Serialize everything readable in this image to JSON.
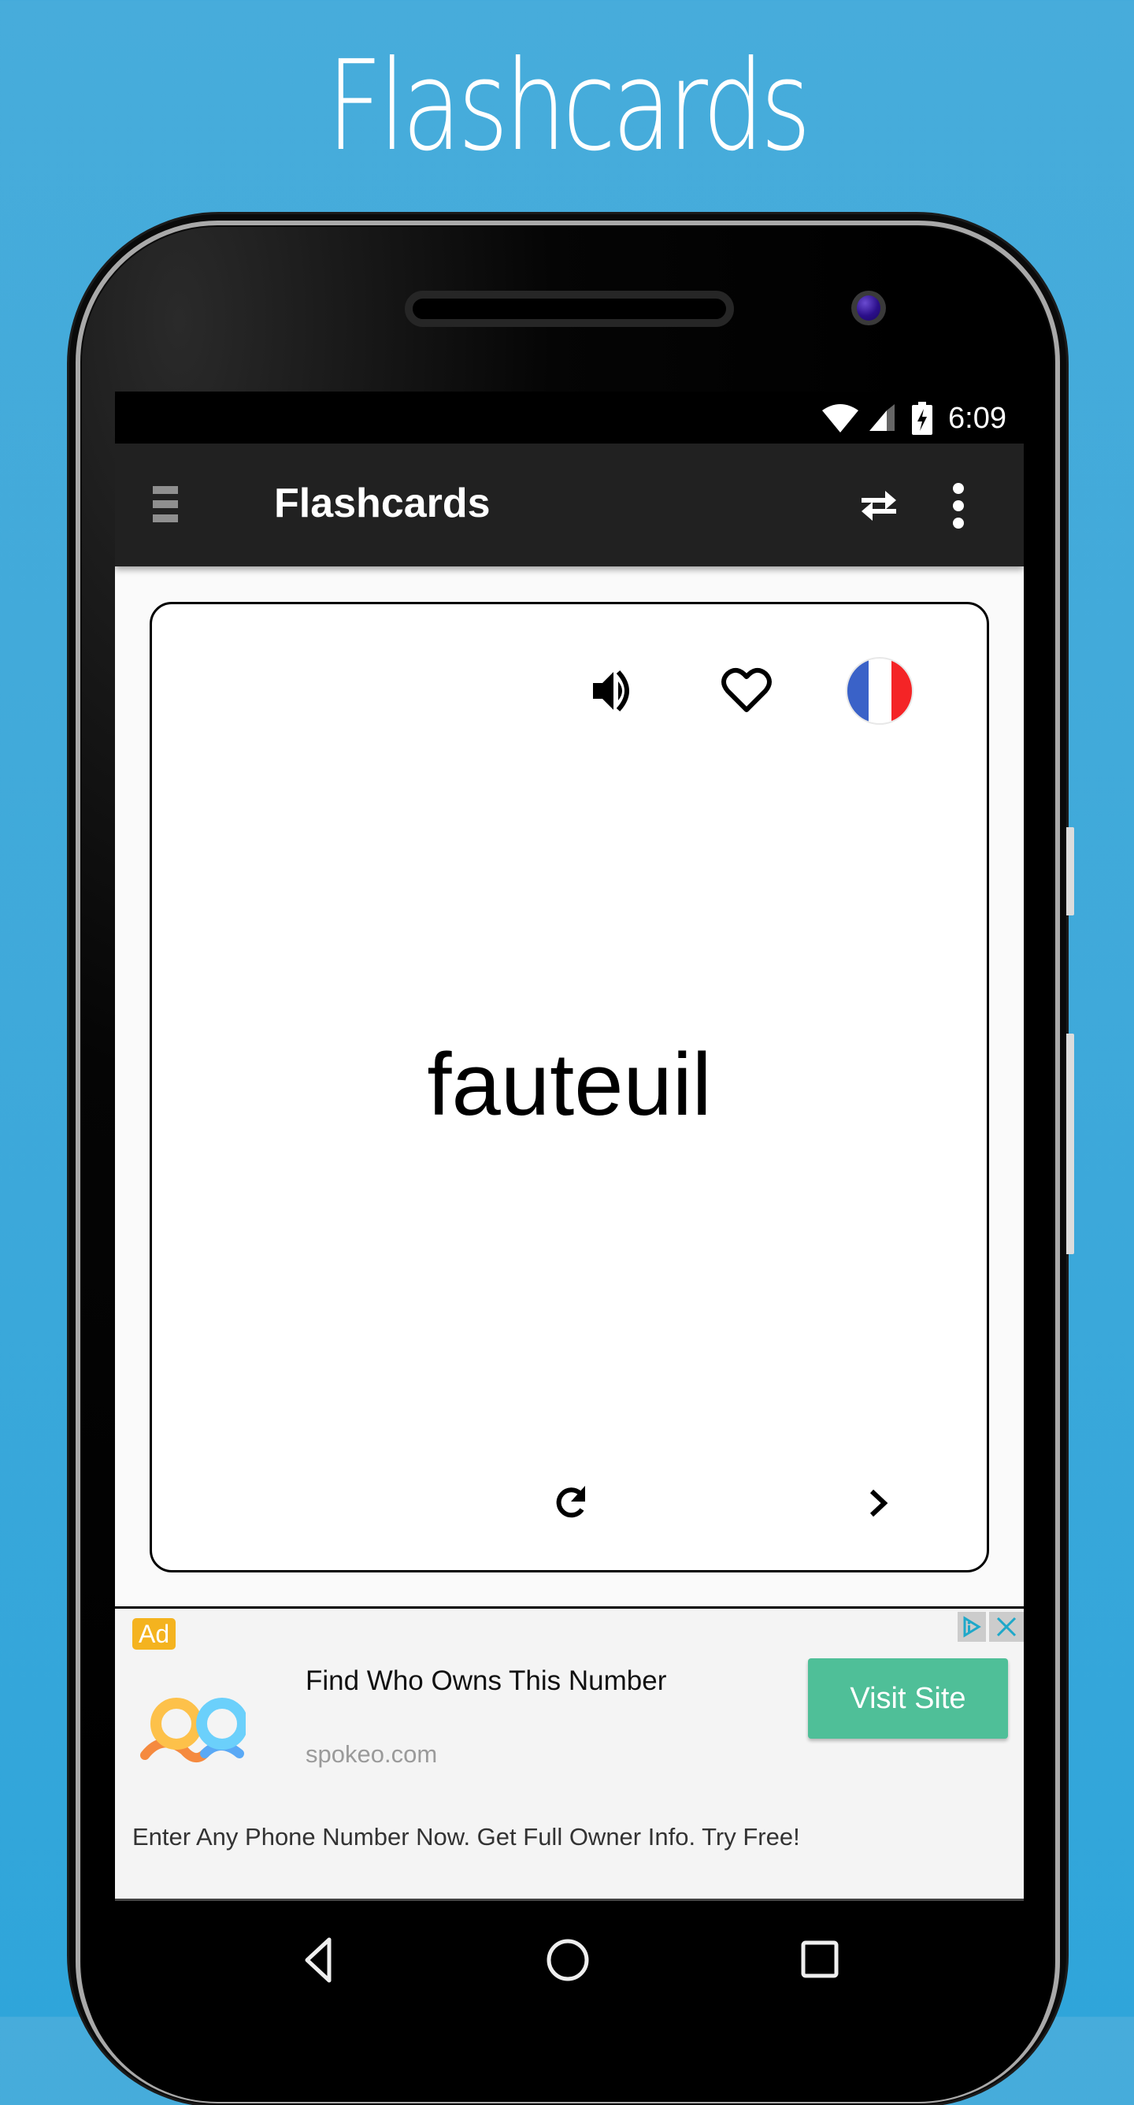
{
  "promo": {
    "title": "Flashcards"
  },
  "status_bar": {
    "time": "6:09",
    "icons": [
      "wifi-icon",
      "cell-signal-icon",
      "battery-charging-icon"
    ]
  },
  "app_bar": {
    "title": "Flashcards",
    "icons": {
      "menu": "hamburger-menu-icon",
      "swap": "swap-arrows-icon",
      "more": "more-vertical-icon"
    }
  },
  "flashcard": {
    "word": "fauteuil",
    "language": "French",
    "icons": {
      "speaker": "volume-up-icon",
      "favorite": "heart-outline-icon",
      "flag": "france-flag-icon",
      "flip": "refresh-icon",
      "next": "chevron-right-icon"
    }
  },
  "ad": {
    "badge": "Ad",
    "headline": "Find Who Owns This Number",
    "domain": "spokeo.com",
    "cta": "Visit Site",
    "body": "Enter Any Phone Number Now. Get Full Owner Info. Try Free!",
    "colors": {
      "badge": "#f4b31f",
      "cta": "#4fbf98",
      "adchoices": "#1fa8c9"
    }
  },
  "nav_bar": {
    "buttons": [
      "back-icon",
      "home-icon",
      "recents-icon"
    ]
  },
  "colors": {
    "background": "#3fa9da",
    "app_bar": "#212121",
    "flag_blue": "#3a62c8",
    "flag_red": "#f42426"
  }
}
